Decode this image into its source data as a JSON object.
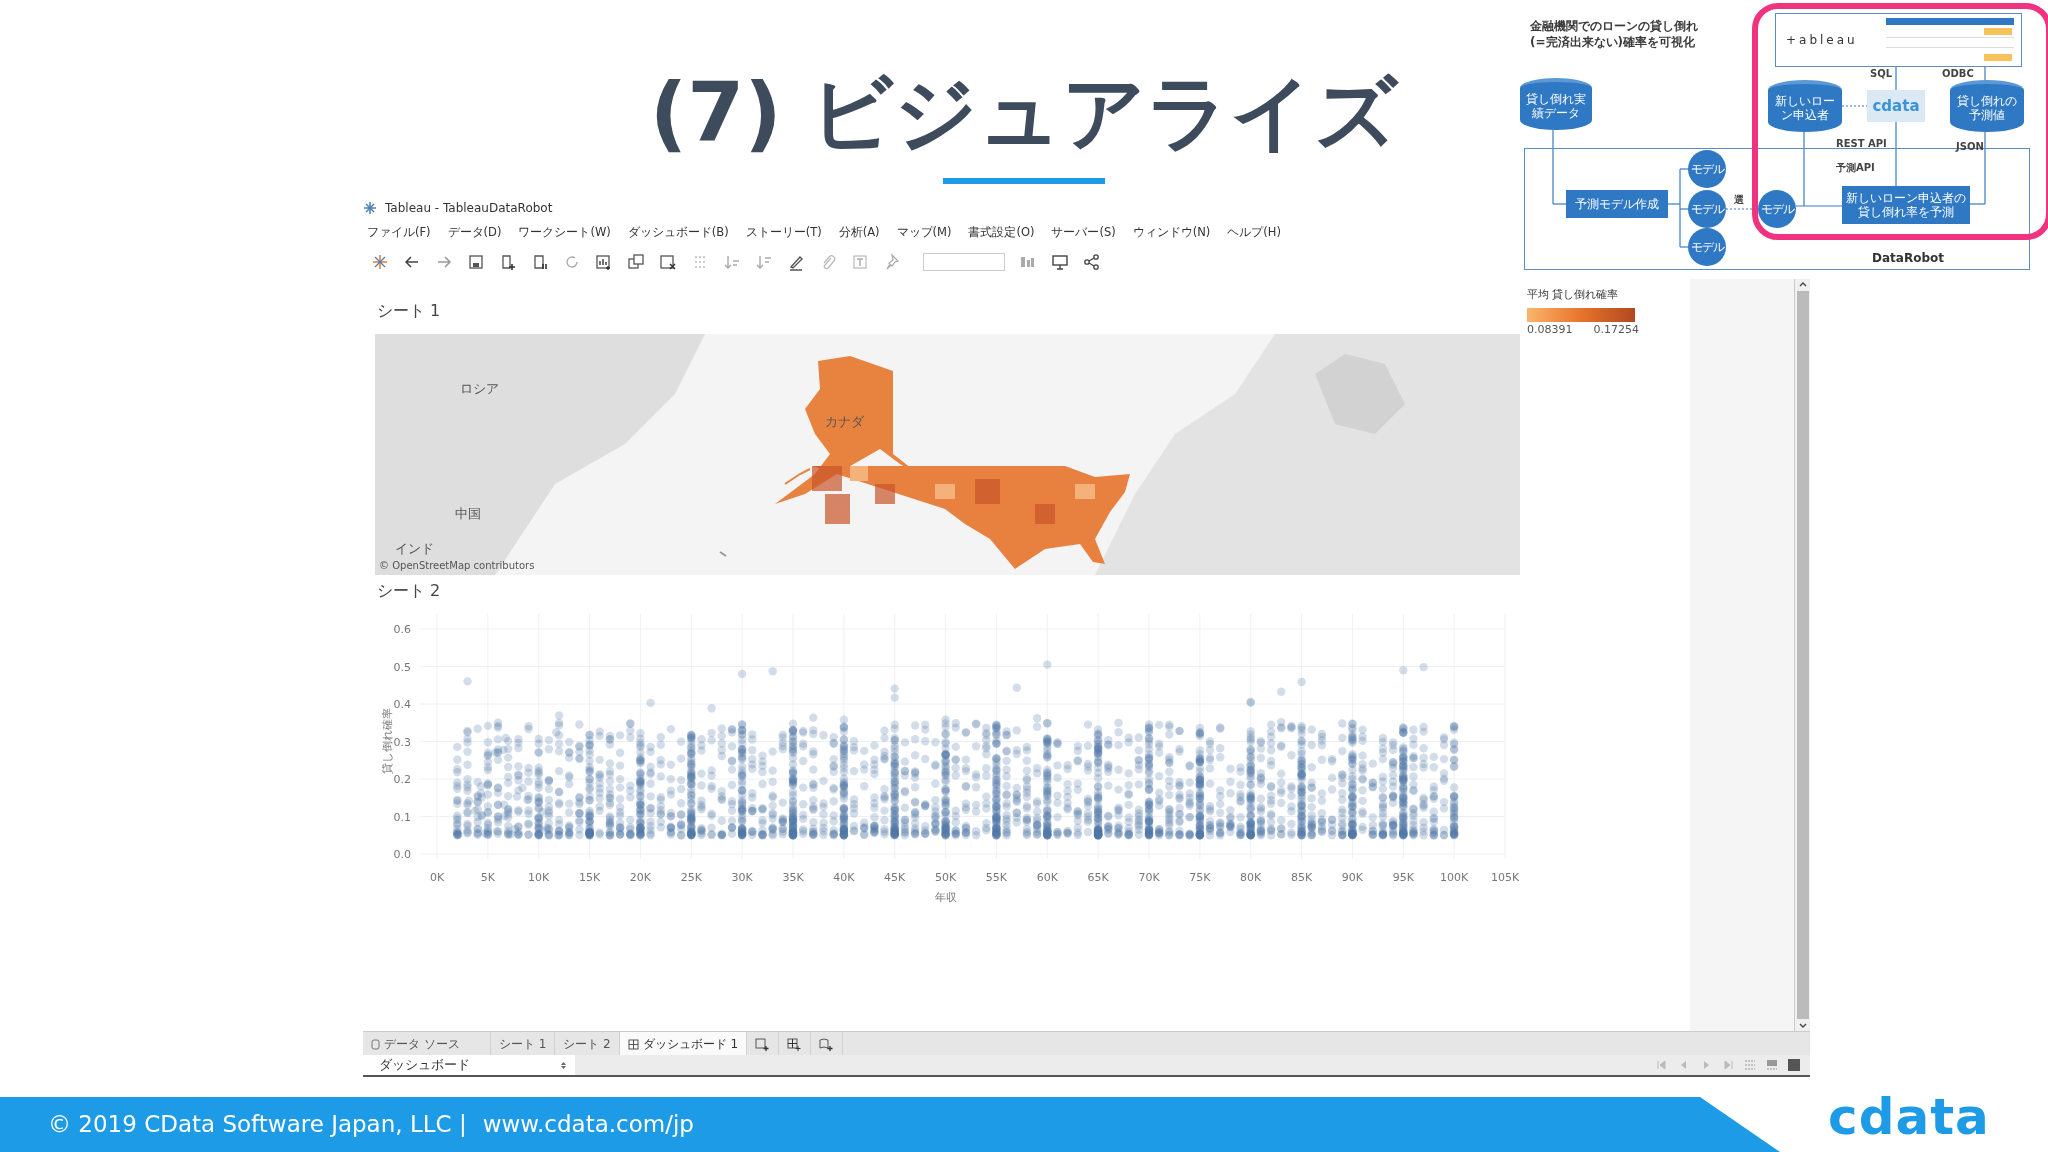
{
  "slide": {
    "title": "(7) ビジュアライズ"
  },
  "diagram": {
    "caption": "金融機関でのローンの貸し倒れ(=完済出来ない)確率を可視化",
    "cylinders": [
      {
        "text": "貸し倒れ実績データ"
      },
      {
        "text": "新しいローン申込者"
      },
      {
        "text": "貸し倒れの予測値"
      }
    ],
    "boxes": [
      {
        "text": "予測モデル作成"
      },
      {
        "text": "新しいローン申込者の貸し倒れ率を予測"
      }
    ],
    "models": [
      {
        "text": "モデル"
      },
      {
        "text": "モデル"
      },
      {
        "text": "モデル"
      },
      {
        "text": "モデル"
      }
    ],
    "select_label": "選",
    "labels": [
      {
        "text": "SQL"
      },
      {
        "text": "ODBC"
      },
      {
        "text": "REST API"
      },
      {
        "text": "JSON"
      },
      {
        "text": "予測API"
      }
    ],
    "tableau_logo": "+ableau",
    "cdata_logo": "cdata",
    "platform": "DataRobot"
  },
  "window": {
    "title": "Tableau - TableauDataRobot"
  },
  "menu": [
    "ファイル(F)",
    "データ(D)",
    "ワークシート(W)",
    "ダッシュボード(B)",
    "ストーリー(T)",
    "分析(A)",
    "マップ(M)",
    "書式設定(O)",
    "サーバー(S)",
    "ウィンドウ(N)",
    "ヘルプ(H)"
  ],
  "dashboard": {
    "sheet1_title": "シート 1",
    "sheet2_title": "シート 2",
    "map_labels": [
      {
        "text": "ロシア"
      },
      {
        "text": "カナダ"
      },
      {
        "text": "中国"
      },
      {
        "text": "インド"
      }
    ],
    "attribution": "© OpenStreetMap contributors",
    "legend": {
      "title": "平均 貸し倒れ確率",
      "min": "0.08391",
      "max": "0.17254"
    },
    "scatter": {
      "y_title": "貸し倒れ確率",
      "x_title": "年収",
      "yticks": [
        "0.6",
        "0.5",
        "0.4",
        "0.3",
        "0.2",
        "0.1",
        "0.0"
      ],
      "xticks": [
        "0K",
        "5K",
        "10K",
        "15K",
        "20K",
        "25K",
        "30K",
        "35K",
        "40K",
        "45K",
        "50K",
        "55K",
        "60K",
        "65K",
        "70K",
        "75K",
        "80K",
        "85K",
        "90K",
        "95K",
        "100K",
        "105K"
      ]
    }
  },
  "tabs": [
    {
      "label": "データ ソース",
      "kind": "datasource",
      "selected": false
    },
    {
      "label": "シート 1",
      "kind": "sheet",
      "selected": false
    },
    {
      "label": "シート 2",
      "kind": "sheet",
      "selected": false
    },
    {
      "label": "ダッシュボード 1",
      "kind": "dashboard",
      "selected": true
    }
  ],
  "status_bar": {
    "dropdown": "ダッシュボード"
  },
  "footer": {
    "copyright": "© 2019 CData Software Japan, LLC |",
    "url": "www.cdata.com/jp",
    "logo": "cdata"
  }
}
